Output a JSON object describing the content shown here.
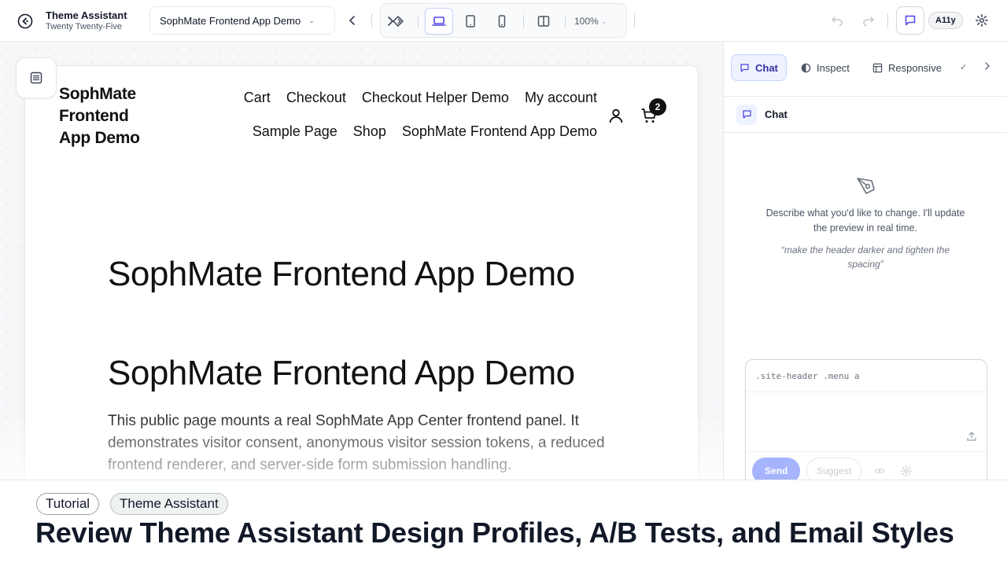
{
  "topbar": {
    "app_title": "Theme Assistant",
    "app_subtitle": "Twenty Twenty-Five",
    "page_select": "SophMate Frontend App Demo",
    "zoom": "100%",
    "a11y": "A11y"
  },
  "site": {
    "title": "SophMate Frontend App Demo",
    "menu_row1": [
      "Cart",
      "Checkout",
      "Checkout Helper Demo",
      "My account"
    ],
    "menu_row2": [
      "Sample Page",
      "Shop",
      "SophMate Frontend App Demo"
    ],
    "cart_count": "2",
    "heading1": "SophMate Frontend App Demo",
    "heading2": "SophMate Frontend App Demo",
    "paragraph": "This public page mounts a real SophMate App Center frontend panel. It demonstrates visitor consent, anonymous visitor session tokens, a reduced frontend renderer, and server-side form submission handling."
  },
  "panel": {
    "tabs": [
      "Chat",
      "Inspect",
      "Responsive"
    ],
    "chat_header": "Chat",
    "empty_text": "Describe what you'd like to change. I'll update the preview in real time.",
    "empty_example": "“make the header darker and tighten the spacing”",
    "selector": ".site-header .menu a",
    "send": "Send",
    "suggest": "Suggest"
  },
  "caption": {
    "tags": [
      "Tutorial",
      "Theme Assistant"
    ],
    "headline": "Review Theme Assistant Design Profiles, A/B Tests, and Email Styles"
  },
  "colors": {
    "accent": "#4f46e5",
    "accent_light": "#eef2ff",
    "send_disabled": "#a5b4fc"
  },
  "icons": [
    "back-circle-icon",
    "chevron-down-icon",
    "chevron-left-icon",
    "chevron-right-icon",
    "diamond-icon",
    "laptop-icon",
    "tablet-icon",
    "phone-icon",
    "split-view-icon",
    "undo-icon",
    "redo-icon",
    "chat-bubble-icon",
    "gear-icon",
    "sidebar-list-icon",
    "user-icon",
    "cart-icon",
    "contrast-icon",
    "layout-icon",
    "pen-tool-icon",
    "upload-icon",
    "link-icon"
  ]
}
